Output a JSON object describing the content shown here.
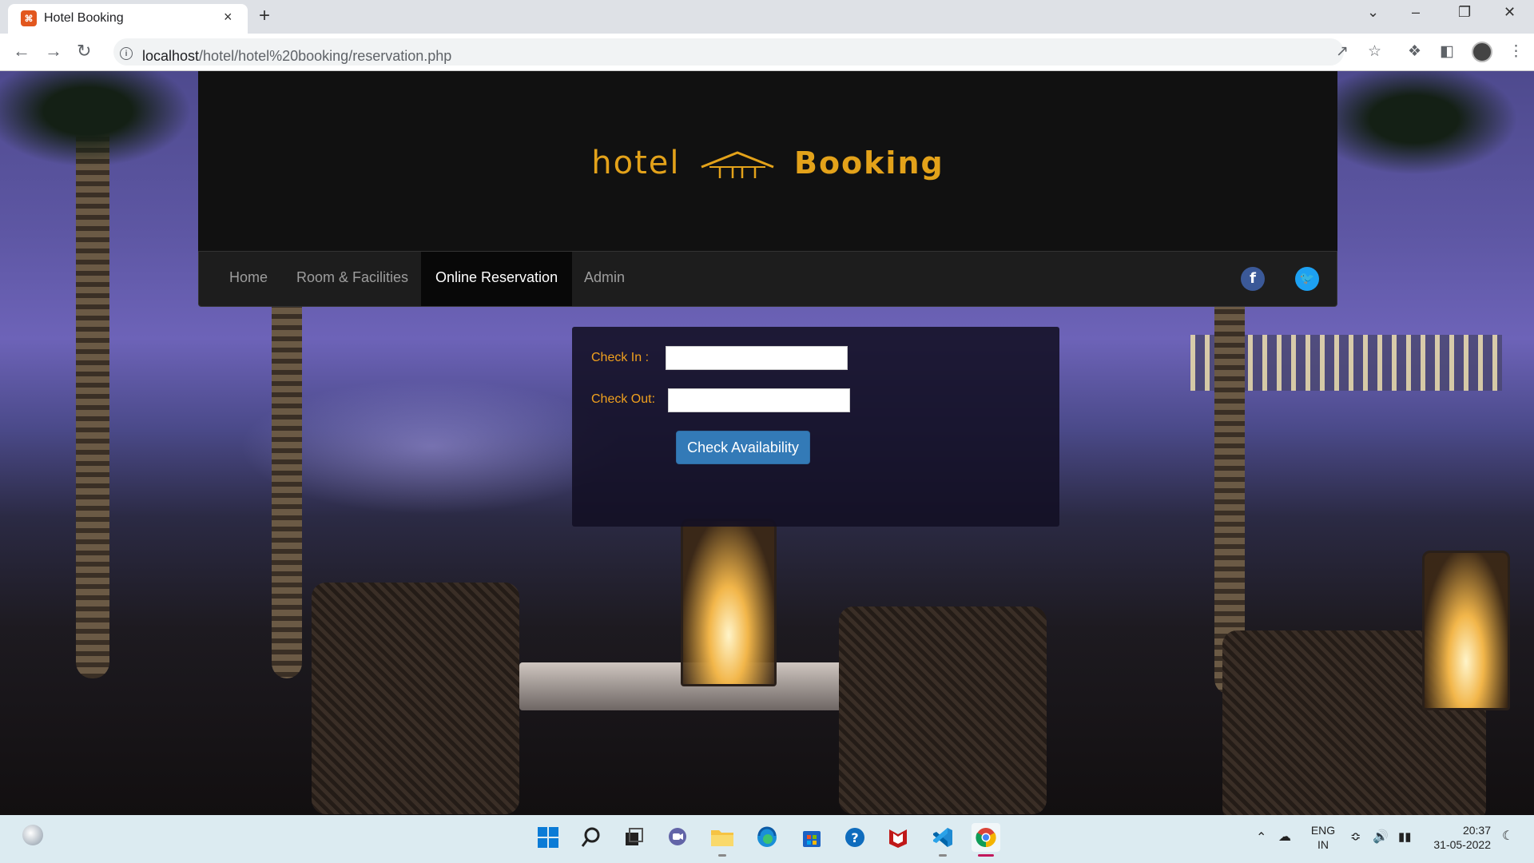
{
  "browser": {
    "tab_title": "Hotel Booking",
    "tab_favicon_glyph": "⌘",
    "tab_close": "×",
    "new_tab": "+",
    "url_host": "localhost",
    "url_path": "/hotel/hotel%20booking/reservation.php",
    "window_controls": [
      "⌄",
      "–",
      "❐",
      "✕"
    ]
  },
  "site": {
    "logo_word1": "hotel",
    "logo_word2": "Booking",
    "logo_color": "#e3a21a",
    "nav": [
      {
        "label": "Home",
        "active": false
      },
      {
        "label": "Room & Facilities",
        "active": false
      },
      {
        "label": "Online Reservation",
        "active": true
      },
      {
        "label": "Admin",
        "active": false
      }
    ],
    "social": {
      "facebook": "f",
      "twitter": "🐦"
    }
  },
  "reservation": {
    "check_in_label": "Check In :",
    "check_in_value": "",
    "check_out_label": "Check Out:",
    "check_out_value": "",
    "button_label": "Check Availability",
    "label_color": "#f0a01e",
    "button_color": "#337ab7"
  },
  "taskbar": {
    "apps": [
      "start",
      "search",
      "task-view",
      "teams-chat",
      "file-explorer",
      "edge",
      "microsoft-store",
      "help",
      "mcafee",
      "vscode",
      "chrome"
    ],
    "language_line1": "ENG",
    "language_line2": "IN",
    "time": "20:37",
    "date": "31-05-2022"
  }
}
